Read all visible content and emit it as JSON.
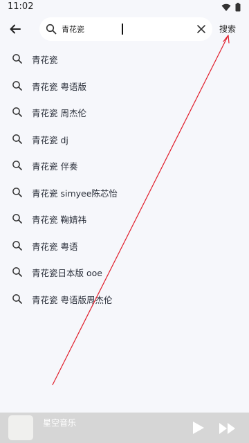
{
  "status_bar": {
    "time": "11:02",
    "icons": [
      "wifi-icon",
      "battery-icon"
    ]
  },
  "top_bar": {
    "back_icon": "arrow-left-icon",
    "search": {
      "value": "青花瓷",
      "placeholder": "",
      "icon": "search-icon",
      "clear_icon": "close-icon"
    },
    "search_button_label": "搜索"
  },
  "suggestions": [
    "青花瓷",
    "青花瓷 粤语版",
    "青花瓷 周杰伦",
    "青花瓷 dj",
    "青花瓷 伴奏",
    "青花瓷 simyee陈芯怡",
    "青花瓷 鞠婧祎",
    "青花瓷 粤语",
    "青花瓷日本版 ooe",
    "青花瓷 粤语版周杰伦"
  ],
  "player": {
    "title": "星空音乐",
    "play_icon": "play-icon",
    "next_icon": "fast-forward-icon"
  },
  "colors": {
    "background": "#f6f7fb",
    "player_bar": "#d6d6d6",
    "annotation_line": "#e11d2a"
  }
}
